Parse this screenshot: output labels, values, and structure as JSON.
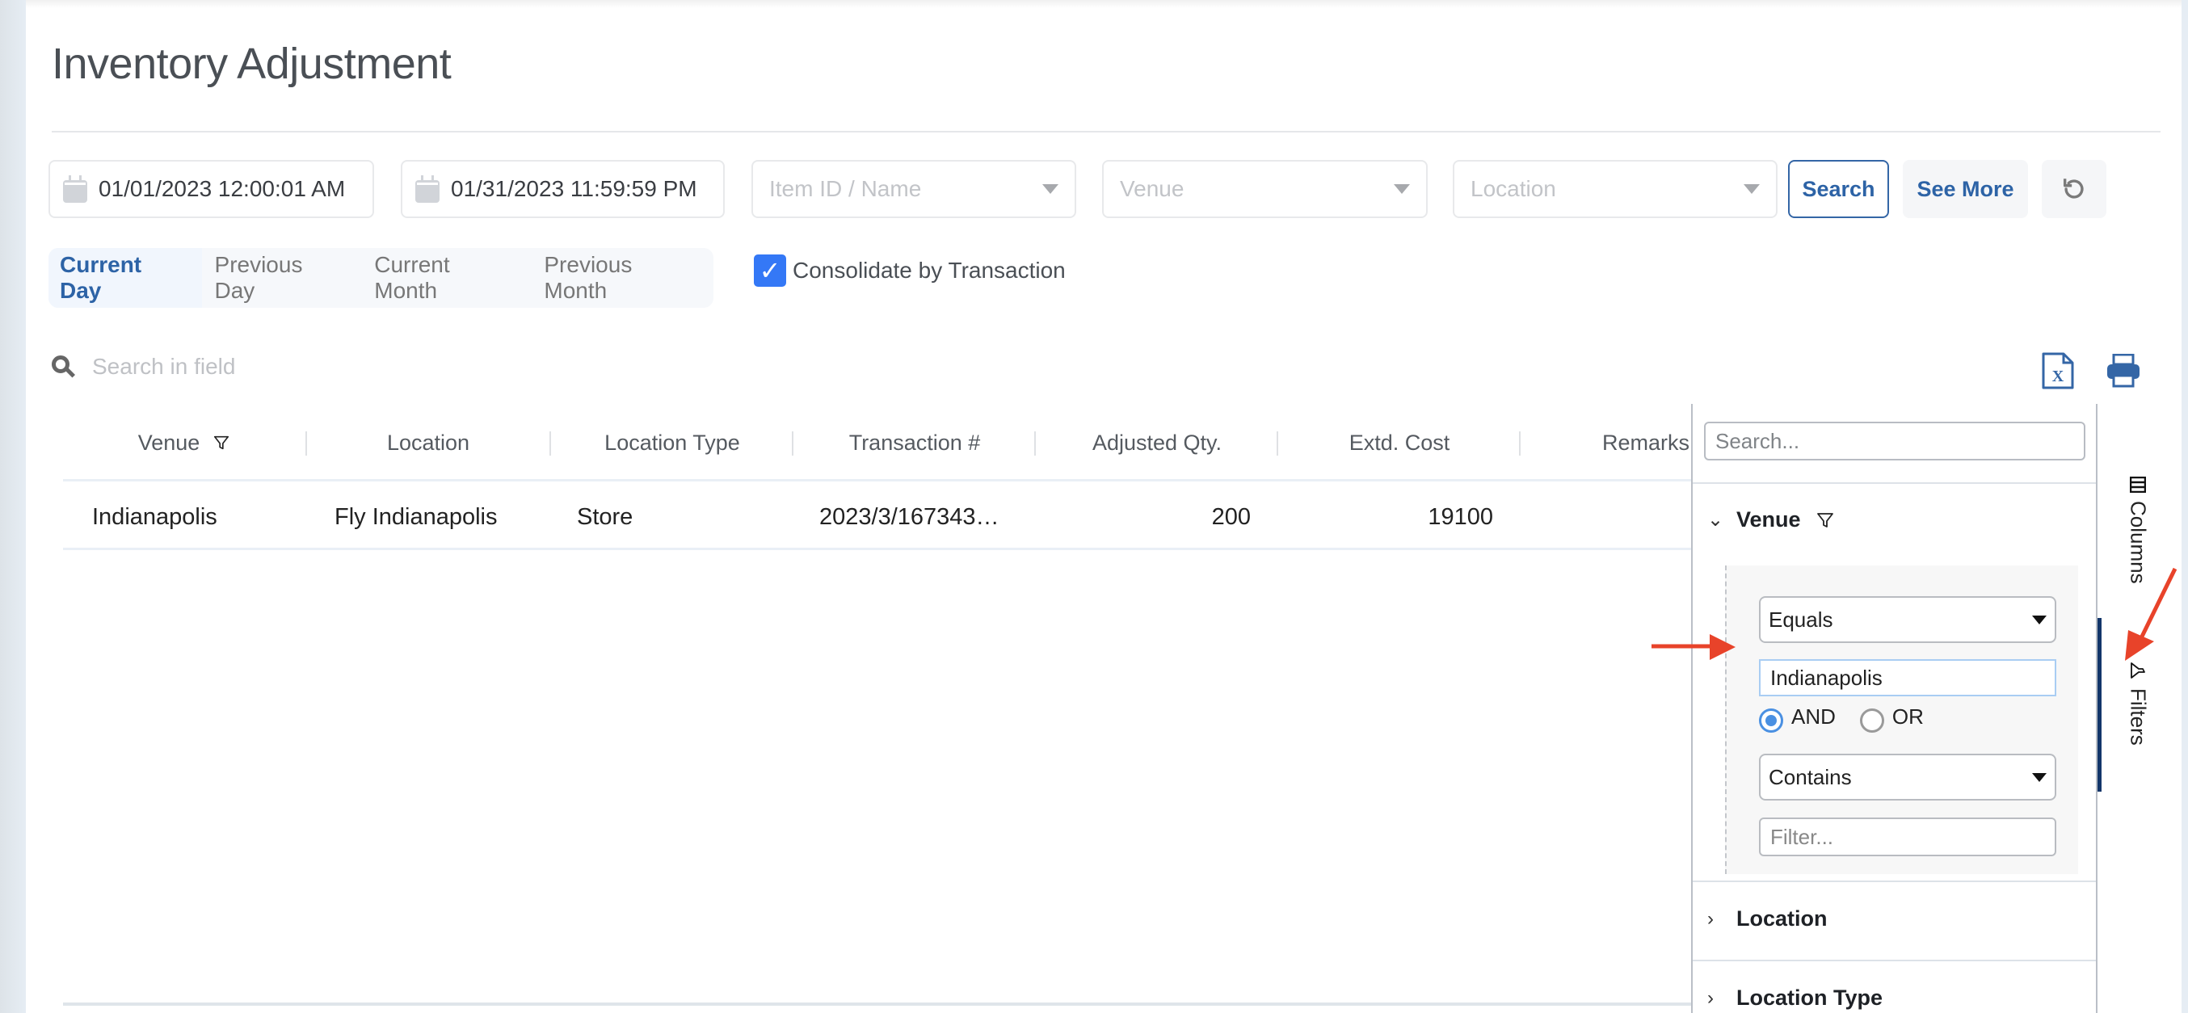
{
  "page": {
    "title": "Inventory Adjustment"
  },
  "filters": {
    "start_date": "01/01/2023 12:00:01 AM",
    "end_date": "01/31/2023 11:59:59 PM",
    "item_placeholder": "Item ID / Name",
    "venue_placeholder": "Venue",
    "location_placeholder": "Location",
    "search_label": "Search",
    "see_more_label": "See More",
    "reset_icon": "reset-icon"
  },
  "quick_ranges": [
    {
      "label": "Current Day",
      "active": true
    },
    {
      "label": "Previous Day",
      "active": false
    },
    {
      "label": "Current Month",
      "active": false
    },
    {
      "label": "Previous Month",
      "active": false
    }
  ],
  "consolidate": {
    "label": "Consolidate by Transaction",
    "checked": true
  },
  "field_search": {
    "placeholder": "Search in field"
  },
  "toolbar": {
    "excel_icon": "excel-export-icon",
    "print_icon": "print-icon"
  },
  "grid": {
    "columns": [
      "Venue",
      "Location",
      "Location Type",
      "Transaction #",
      "Adjusted Qty.",
      "Extd. Cost",
      "Remarks"
    ],
    "rows": [
      {
        "venue": "Indianapolis",
        "location": "Fly Indianapolis",
        "location_type": "Store",
        "transaction": "2023/3/167343…",
        "adjusted_qty": "200",
        "extd_cost": "19100",
        "remarks": ""
      }
    ]
  },
  "side_panel": {
    "search_placeholder": "Search...",
    "groups": [
      {
        "label": "Venue",
        "expanded": true,
        "filtered": true
      },
      {
        "label": "Location",
        "expanded": false
      },
      {
        "label": "Location Type",
        "expanded": false
      }
    ],
    "venue_filter": {
      "condition1_operator": "Equals",
      "condition1_value": "Indianapolis",
      "join_and": "AND",
      "join_or": "OR",
      "join_selected": "AND",
      "condition2_operator": "Contains",
      "condition2_placeholder": "Filter..."
    },
    "tabs": [
      {
        "label": "Columns",
        "active": false
      },
      {
        "label": "Filters",
        "active": true
      }
    ]
  },
  "colors": {
    "accent": "#2d63a6",
    "checkbox": "#3478f6",
    "annotation_arrow": "#e8432a",
    "active_tab_bar": "#14366a"
  }
}
